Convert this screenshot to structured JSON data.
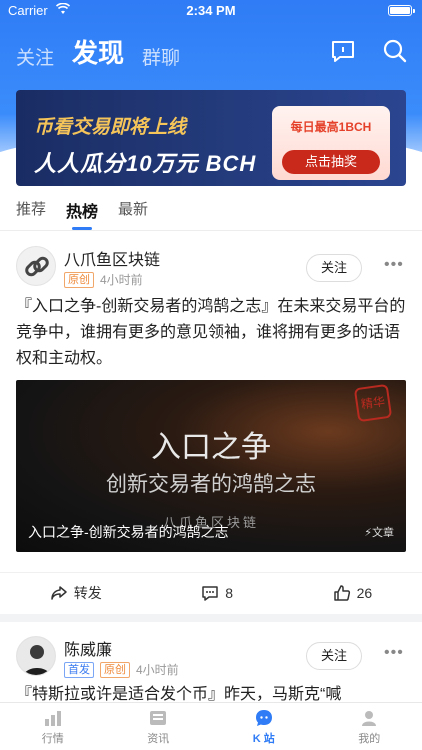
{
  "status_bar": {
    "carrier": "Carrier",
    "time": "2:34 PM"
  },
  "top_nav": {
    "tabs": [
      "关注",
      "发现",
      "群聊"
    ],
    "active_tab": "发现"
  },
  "banner": {
    "line1": "币看交易即将上线",
    "line2": "人人瓜分10万元 BCH",
    "card_text": "每日最高1BCH",
    "card_button": "点击抽奖"
  },
  "sub_tabs": {
    "tabs": [
      "推荐",
      "热榜",
      "最新"
    ],
    "active": "热榜"
  },
  "post1": {
    "author": "八爪鱼区块链",
    "tag": "原创",
    "time": "4小时前",
    "follow_label": "关注",
    "text": "『入口之争-创新交易者的鸿鹄之志』在未来交易平台的竞争中，谁拥有更多的意见领袖，谁将拥有更多的话语权和主动权。",
    "image": {
      "title": "入口之争",
      "subtitle": "创新交易者的鸿鹄之志",
      "brand": "八爪鱼区块链",
      "caption": "入口之争-创新交易者的鸿鹄之志",
      "type": "文章",
      "seal": "精华"
    },
    "actions": {
      "share_label": "转发",
      "comments": "8",
      "likes": "26"
    }
  },
  "post2": {
    "author": "陈威廉",
    "tags": [
      "首发",
      "原创"
    ],
    "time": "4小时前",
    "follow_label": "关注",
    "text": "『特斯拉或许是适合发个币』昨天，马斯克“喊"
  },
  "tabbar": {
    "items": [
      "行情",
      "资讯",
      "K 站",
      "我的"
    ],
    "active": "K 站"
  },
  "colors": {
    "accent": "#2f7cf6",
    "tag_orange": "#ef8a3a"
  }
}
